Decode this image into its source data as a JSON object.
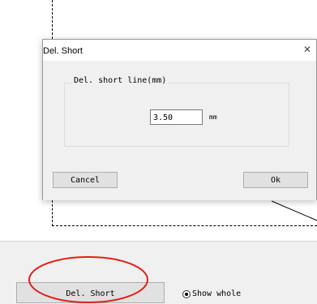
{
  "dialog": {
    "title": "Del. Short",
    "close_icon": "close-icon",
    "group_label": "Del. short line(mm)",
    "length_value": "3.50",
    "unit": "mm",
    "cancel_label": "Cancel",
    "ok_label": "Ok"
  },
  "toolbar": {
    "del_short_label": "Del. Short",
    "show_whole_label": "Show whole",
    "show_whole_checked": true
  },
  "annotation": {
    "highlight_color": "#e0201b"
  }
}
